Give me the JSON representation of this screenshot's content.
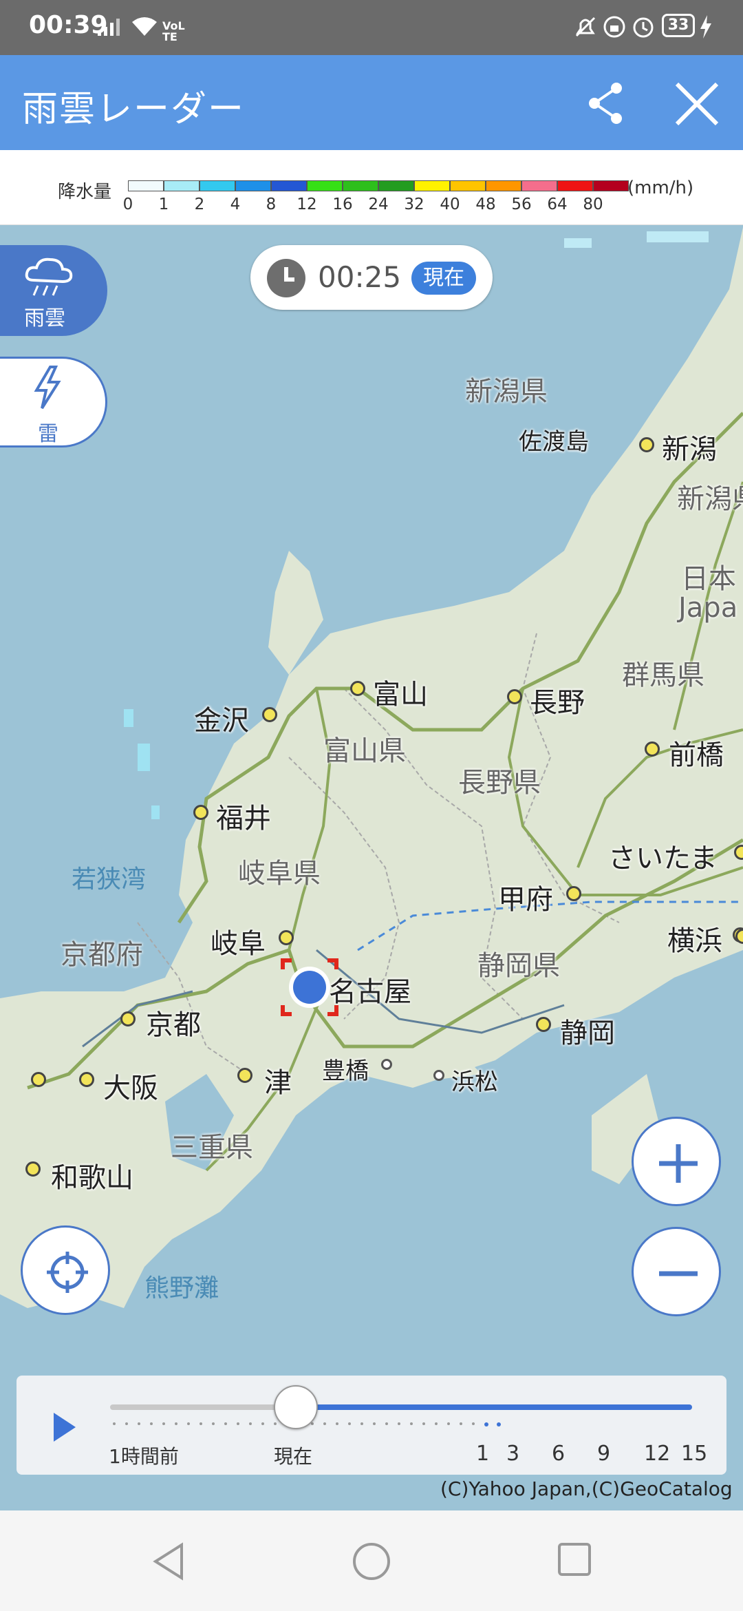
{
  "status_bar": {
    "time": "00:39",
    "network": "VoLTE",
    "battery": "33"
  },
  "header": {
    "title": "雨雲レーダー",
    "share_icon": "share-icon",
    "close_icon": "close-icon"
  },
  "legend": {
    "label": "降水量",
    "unit": "(mm/h)",
    "ticks": [
      "0",
      "1",
      "2",
      "4",
      "8",
      "12",
      "16",
      "24",
      "32",
      "40",
      "48",
      "56",
      "64",
      "80"
    ],
    "colors": [
      "#f2fbfd",
      "#a8ecf7",
      "#33c9ef",
      "#1e90e8",
      "#2457d4",
      "#36e016",
      "#2ebf1c",
      "#239c20",
      "#fff200",
      "#ffc400",
      "#ff9600",
      "#f46e8c",
      "#ef1414",
      "#b4001e"
    ]
  },
  "layers": {
    "rain_label": "雨雲",
    "thunder_label": "雷"
  },
  "time_pill": {
    "time": "00:25",
    "badge": "現在"
  },
  "map": {
    "cities": {
      "niigata": "新潟",
      "kanazawa": "金沢",
      "toyama": "富山",
      "nagano": "長野",
      "maebashi": "前橋",
      "fukui": "福井",
      "saitama": "さいたま",
      "kofu": "甲府",
      "gifu": "岐阜",
      "yokohama": "横浜",
      "nagoya": "名古屋",
      "kyoto": "京都",
      "shizuoka": "静岡",
      "osaka": "大阪",
      "tsu": "津",
      "toyohashi": "豊橋",
      "hamamatsu": "浜松",
      "wakayama": "和歌山"
    },
    "prefectures": {
      "niigata_ken": "新潟県",
      "niigata_ken_cut": "新潟県",
      "gunma_ken": "群馬県",
      "toyama_ken": "富山県",
      "nagano_ken": "長野県",
      "gifu_ken": "岐阜県",
      "shizuoka_ken": "静岡県",
      "kyoto_fu": "京都府",
      "mie_ken": "三重県"
    },
    "places": {
      "sado": "佐渡島",
      "wakasa": "若狭湾",
      "kumano": "熊野灘",
      "japan_ja": "日本",
      "japan_en": "Japa"
    }
  },
  "controls": {
    "locate_icon": "crosshair-icon",
    "zoom_in_icon": "plus-icon",
    "zoom_out_icon": "minus-icon"
  },
  "timeline": {
    "play_icon": "play-icon",
    "label_past": "1時間前",
    "label_now": "現在",
    "hours": [
      "1",
      "3",
      "6",
      "9",
      "12",
      "15"
    ]
  },
  "copyright": "(C)Yahoo Japan,(C)GeoCatalog"
}
